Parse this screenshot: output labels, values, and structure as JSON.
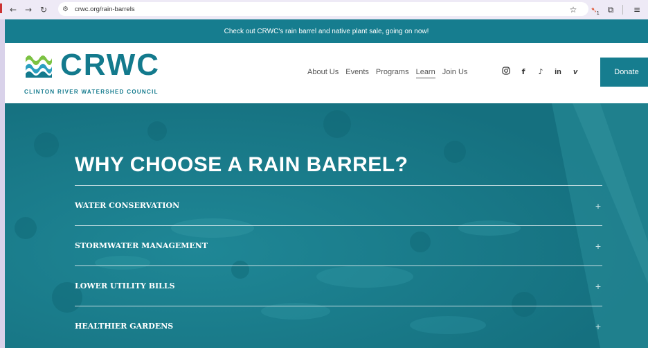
{
  "browser": {
    "url": "crwc.org/rain-barrels",
    "extension_badge": "1"
  },
  "announcement": "Check out CRWC's rain barrel and native plant sale, going on now!",
  "logo": {
    "wordmark": "CRWC",
    "tagline": "CLINTON RIVER WATERSHED COUNCIL"
  },
  "nav": {
    "items": [
      {
        "label": "About Us"
      },
      {
        "label": "Events"
      },
      {
        "label": "Programs"
      },
      {
        "label": "Learn"
      },
      {
        "label": "Join Us"
      }
    ],
    "active": "Learn"
  },
  "social": [
    "instagram-icon",
    "facebook-icon",
    "tiktok-icon",
    "linkedin-icon",
    "vimeo-icon"
  ],
  "donate_label": "Donate",
  "hero": {
    "title": "WHY CHOOSE A RAIN BARREL?",
    "accordion": [
      {
        "title": "WATER CONSERVATION"
      },
      {
        "title": "STORMWATER MANAGEMENT"
      },
      {
        "title": "LOWER UTILITY BILLS"
      },
      {
        "title": "HEALTHIER GARDENS"
      }
    ]
  },
  "colors": {
    "brand_teal": "#167d8f",
    "hero_teal": "#1a7f8f",
    "wave_green": "#7cc242",
    "wave_blue": "#2a9fc0"
  }
}
